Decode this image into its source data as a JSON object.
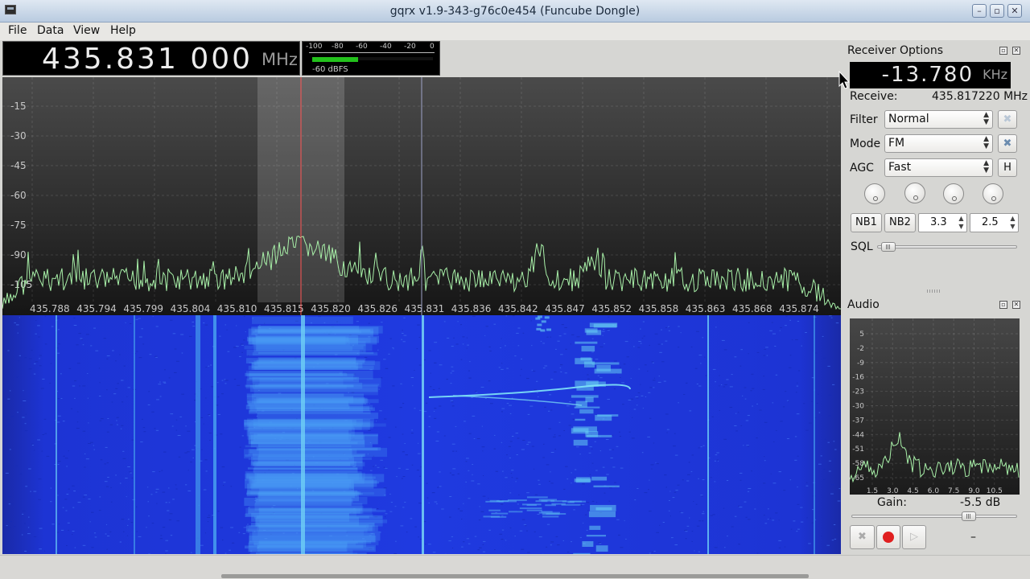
{
  "window": {
    "title": "gqrx v1.9-343-g76c0e454 (Funcube Dongle)",
    "controls": [
      "minimize",
      "maximize",
      "close"
    ]
  },
  "menu": [
    "File",
    "Data",
    "View",
    "Help"
  ],
  "frequency": {
    "value": "435.831 000",
    "unit": "MHz"
  },
  "meter": {
    "ticks": [
      "-100",
      "-80",
      "-60",
      "-40",
      "-20",
      "0"
    ],
    "readout": "-60 dBFS",
    "level_fraction": 0.38,
    "bar_color": "#23c21c"
  },
  "spectrum": {
    "y_ticks": [
      "-15",
      "-30",
      "-45",
      "-60",
      "-75",
      "-90",
      "-105"
    ],
    "x_ticks": [
      "435.788",
      "435.794",
      "435.799",
      "435.804",
      "435.810",
      "435.815",
      "435.820",
      "435.826",
      "435.831",
      "435.836",
      "435.842",
      "435.847",
      "435.852",
      "435.858",
      "435.863",
      "435.868",
      "435.874"
    ],
    "trace_color": "#a8f0a8",
    "filter_color": "#ff5555",
    "center_line_color": "#9ea3c8"
  },
  "receiver": {
    "title": "Receiver Options",
    "offset": {
      "value": "-13.780",
      "unit": "KHz"
    },
    "receive_label": "Receive:",
    "receive_value": "435.817220 MHz",
    "filter_label": "Filter",
    "filter_value": "Normal",
    "mode_label": "Mode",
    "mode_value": "FM",
    "agc_label": "AGC",
    "agc_value": "Fast",
    "agc_button": "H",
    "nb1": "NB1",
    "nb2": "NB2",
    "nb1_value": "3.3",
    "nb2_value": "2.5",
    "sql_label": "SQL",
    "sql_level_fraction": 0.03
  },
  "audio": {
    "title": "Audio",
    "y_ticks": [
      "5",
      "-2",
      "-9",
      "-16",
      "-23",
      "-30",
      "-37",
      "-44",
      "-51",
      "-58",
      "-65"
    ],
    "x_ticks": [
      "1.5",
      "3.0",
      "4.5",
      "6.0",
      "7.5",
      "9.0",
      "10.5"
    ],
    "gain_label": "Gain:",
    "gain_value": "-5.5 dB",
    "gain_level_fraction": 0.73,
    "status_dash": "–",
    "record_color": "#e02020"
  }
}
